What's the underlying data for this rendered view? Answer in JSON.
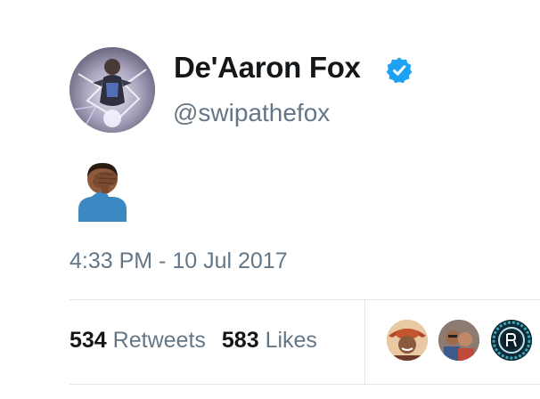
{
  "user": {
    "display_name": "De'Aaron Fox",
    "handle": "@swipathefox",
    "verified": true,
    "verified_color": "#1da1f2"
  },
  "tweet": {
    "emoji": "🤦🏾‍♂️",
    "emoji_icon": "man-facepalming-icon",
    "timestamp": "4:33 PM - 10 Jul 2017"
  },
  "stats": {
    "retweets_count": "534",
    "retweets_label": "Retweets",
    "likes_count": "583",
    "likes_label": "Likes"
  },
  "colors": {
    "text_primary": "#14171a",
    "text_secondary": "#657786",
    "divider": "#e1e8ed"
  }
}
